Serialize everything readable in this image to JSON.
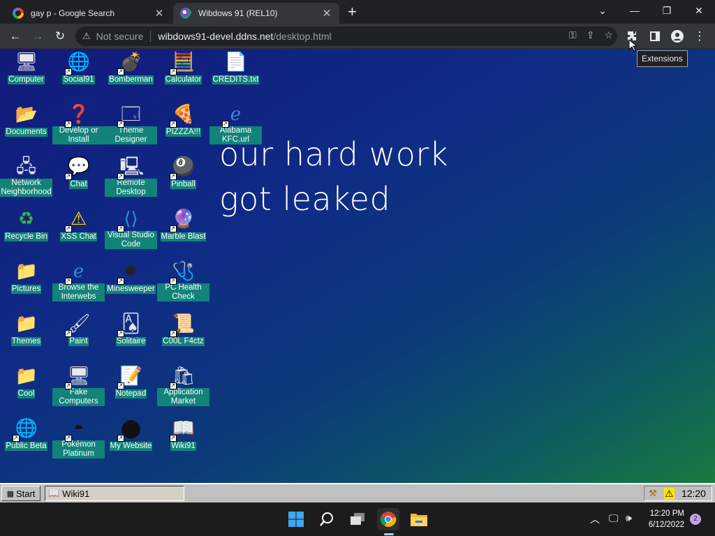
{
  "browser": {
    "tabs": [
      {
        "title": "gay p - Google Search",
        "favicon": "google-favicon",
        "active": false
      },
      {
        "title": "Wibdows 91 (REL10)",
        "favicon": "windows91-favicon",
        "active": true
      }
    ],
    "address": {
      "security_label": "Not secure",
      "url_host": "wibdows91-devel.ddns.net",
      "url_path": "/desktop.html"
    },
    "tooltip": "Extensions"
  },
  "desktop": {
    "icons": [
      {
        "label": "Computer",
        "icon": "computer-icon",
        "shortcut": false
      },
      {
        "label": "Social91",
        "icon": "globe-icon",
        "shortcut": true
      },
      {
        "label": "Bomberman",
        "icon": "bomberman-icon",
        "shortcut": true
      },
      {
        "label": "Calculator",
        "icon": "calculator-icon",
        "shortcut": true
      },
      {
        "label": "CREDITS.txt",
        "icon": "text-file-icon",
        "shortcut": false
      },
      {
        "label": "Documents",
        "icon": "folder-documents-icon",
        "shortcut": false
      },
      {
        "label": "Develop or Install",
        "icon": "help-install-icon",
        "shortcut": true
      },
      {
        "label": "Theme Designer",
        "icon": "window-icon",
        "shortcut": true
      },
      {
        "label": "PIZZZA!!!",
        "icon": "pizza-icon",
        "shortcut": true
      },
      {
        "label": "Alabama KFC.url",
        "icon": "internet-explorer-icon",
        "shortcut": true
      },
      {
        "label": "Network Neighborhood",
        "icon": "network-icon",
        "shortcut": false
      },
      {
        "label": "Chat",
        "icon": "chat-bubble-icon",
        "shortcut": true
      },
      {
        "label": "Remote Desktop",
        "icon": "remote-desktop-icon",
        "shortcut": true
      },
      {
        "label": "Pinball",
        "icon": "pinball-icon",
        "shortcut": true
      },
      {
        "label": "Recycle Bin",
        "icon": "recycle-bin-icon",
        "shortcut": false
      },
      {
        "label": "XSS Chat",
        "icon": "chat-warning-icon",
        "shortcut": true
      },
      {
        "label": "Visual Studio Code",
        "icon": "vscode-icon",
        "shortcut": true
      },
      {
        "label": "Marble Blast",
        "icon": "marble-icon",
        "shortcut": true
      },
      {
        "label": "Pictures",
        "icon": "folder-icon",
        "shortcut": false
      },
      {
        "label": "Browse the Interwebs",
        "icon": "internet-explorer-icon",
        "shortcut": true
      },
      {
        "label": "Minesweeper",
        "icon": "mine-icon",
        "shortcut": true
      },
      {
        "label": "PC Health Check",
        "icon": "health-check-icon",
        "shortcut": true
      },
      {
        "label": "Themes",
        "icon": "folder-icon",
        "shortcut": false
      },
      {
        "label": "Paint",
        "icon": "paint-icon",
        "shortcut": true
      },
      {
        "label": "Solitaire",
        "icon": "cards-icon",
        "shortcut": true
      },
      {
        "label": "C00L F4ctz",
        "icon": "certificate-icon",
        "shortcut": true
      },
      {
        "label": "Cool",
        "icon": "folder-icon",
        "shortcut": false
      },
      {
        "label": "Fake Computers",
        "icon": "computers-icon",
        "shortcut": true
      },
      {
        "label": "Notepad",
        "icon": "notepad-icon",
        "shortcut": true
      },
      {
        "label": "Application Market",
        "icon": "shopping-bag-icon",
        "shortcut": true
      },
      {
        "label": "Public Beta",
        "icon": "globe-icon",
        "shortcut": true
      },
      {
        "label": "Pokémon Platinum",
        "icon": "pokemon-icon",
        "shortcut": true
      },
      {
        "label": "My Website",
        "icon": "github-icon",
        "shortcut": true
      },
      {
        "label": "Wiki91",
        "icon": "book-icon",
        "shortcut": true
      }
    ],
    "overlay_text": [
      "",
      "our hard work",
      "got leaked"
    ]
  },
  "w91_taskbar": {
    "start_label": "Start",
    "tasks": [
      {
        "label": "Wiki91",
        "icon": "book-icon"
      }
    ],
    "clock": "12:20",
    "tray_icons": [
      "hammer-icon",
      "warning-icon"
    ]
  },
  "win11_taskbar": {
    "apps": [
      "windows-start-icon",
      "search-icon",
      "task-view-icon",
      "chrome-icon",
      "file-explorer-icon"
    ],
    "time": "12:20 PM",
    "date": "6/12/2022",
    "notification_count": "2"
  }
}
